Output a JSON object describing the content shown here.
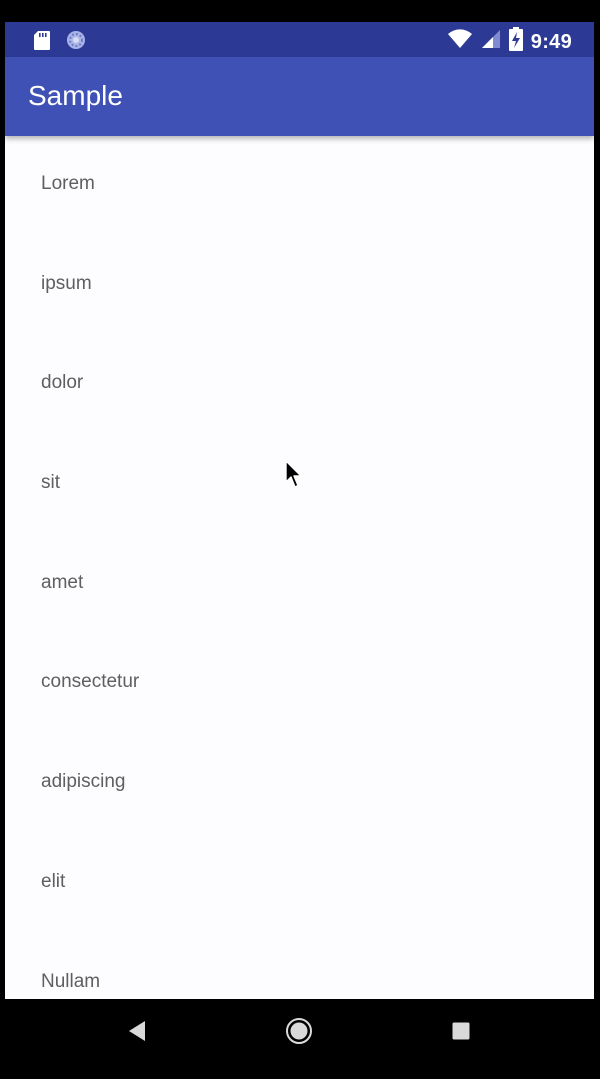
{
  "status_bar": {
    "time": "9:49",
    "icons": [
      "sd-card-icon",
      "sync-circle-icon",
      "wifi-icon",
      "cell-signal-icon",
      "battery-charging-icon"
    ]
  },
  "app_bar": {
    "title": "Sample",
    "color": "#3f51b5"
  },
  "status_bar_color": "#2c3a96",
  "list": {
    "items": [
      {
        "label": "Lorem"
      },
      {
        "label": "ipsum"
      },
      {
        "label": "dolor"
      },
      {
        "label": "sit"
      },
      {
        "label": "amet"
      },
      {
        "label": "consectetur"
      },
      {
        "label": "adipiscing"
      },
      {
        "label": "elit"
      },
      {
        "label": "Nullam"
      }
    ]
  },
  "nav_bar": {
    "buttons": [
      "back-icon",
      "home-icon",
      "recents-icon"
    ]
  }
}
